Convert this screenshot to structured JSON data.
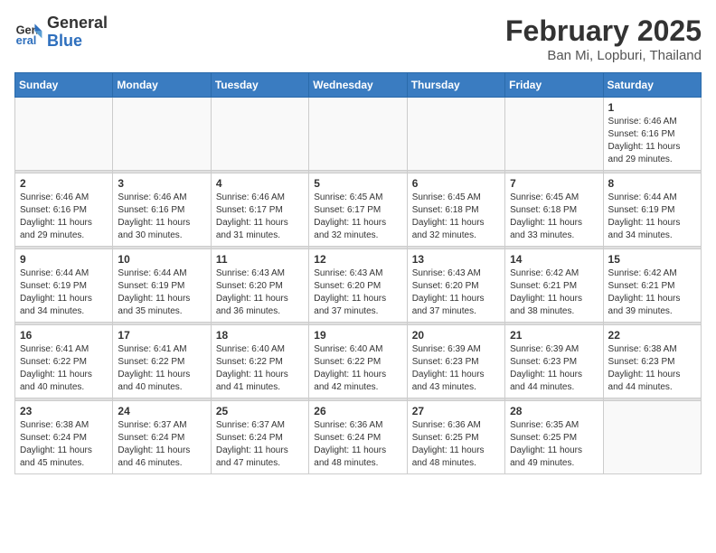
{
  "header": {
    "logo_general": "General",
    "logo_blue": "Blue",
    "month_title": "February 2025",
    "location": "Ban Mi, Lopburi, Thailand"
  },
  "calendar": {
    "days_of_week": [
      "Sunday",
      "Monday",
      "Tuesday",
      "Wednesday",
      "Thursday",
      "Friday",
      "Saturday"
    ],
    "weeks": [
      [
        {
          "day": "",
          "info": ""
        },
        {
          "day": "",
          "info": ""
        },
        {
          "day": "",
          "info": ""
        },
        {
          "day": "",
          "info": ""
        },
        {
          "day": "",
          "info": ""
        },
        {
          "day": "",
          "info": ""
        },
        {
          "day": "1",
          "info": "Sunrise: 6:46 AM\nSunset: 6:16 PM\nDaylight: 11 hours and 29 minutes."
        }
      ],
      [
        {
          "day": "2",
          "info": "Sunrise: 6:46 AM\nSunset: 6:16 PM\nDaylight: 11 hours and 29 minutes."
        },
        {
          "day": "3",
          "info": "Sunrise: 6:46 AM\nSunset: 6:16 PM\nDaylight: 11 hours and 30 minutes."
        },
        {
          "day": "4",
          "info": "Sunrise: 6:46 AM\nSunset: 6:17 PM\nDaylight: 11 hours and 31 minutes."
        },
        {
          "day": "5",
          "info": "Sunrise: 6:45 AM\nSunset: 6:17 PM\nDaylight: 11 hours and 32 minutes."
        },
        {
          "day": "6",
          "info": "Sunrise: 6:45 AM\nSunset: 6:18 PM\nDaylight: 11 hours and 32 minutes."
        },
        {
          "day": "7",
          "info": "Sunrise: 6:45 AM\nSunset: 6:18 PM\nDaylight: 11 hours and 33 minutes."
        },
        {
          "day": "8",
          "info": "Sunrise: 6:44 AM\nSunset: 6:19 PM\nDaylight: 11 hours and 34 minutes."
        }
      ],
      [
        {
          "day": "9",
          "info": "Sunrise: 6:44 AM\nSunset: 6:19 PM\nDaylight: 11 hours and 34 minutes."
        },
        {
          "day": "10",
          "info": "Sunrise: 6:44 AM\nSunset: 6:19 PM\nDaylight: 11 hours and 35 minutes."
        },
        {
          "day": "11",
          "info": "Sunrise: 6:43 AM\nSunset: 6:20 PM\nDaylight: 11 hours and 36 minutes."
        },
        {
          "day": "12",
          "info": "Sunrise: 6:43 AM\nSunset: 6:20 PM\nDaylight: 11 hours and 37 minutes."
        },
        {
          "day": "13",
          "info": "Sunrise: 6:43 AM\nSunset: 6:20 PM\nDaylight: 11 hours and 37 minutes."
        },
        {
          "day": "14",
          "info": "Sunrise: 6:42 AM\nSunset: 6:21 PM\nDaylight: 11 hours and 38 minutes."
        },
        {
          "day": "15",
          "info": "Sunrise: 6:42 AM\nSunset: 6:21 PM\nDaylight: 11 hours and 39 minutes."
        }
      ],
      [
        {
          "day": "16",
          "info": "Sunrise: 6:41 AM\nSunset: 6:22 PM\nDaylight: 11 hours and 40 minutes."
        },
        {
          "day": "17",
          "info": "Sunrise: 6:41 AM\nSunset: 6:22 PM\nDaylight: 11 hours and 40 minutes."
        },
        {
          "day": "18",
          "info": "Sunrise: 6:40 AM\nSunset: 6:22 PM\nDaylight: 11 hours and 41 minutes."
        },
        {
          "day": "19",
          "info": "Sunrise: 6:40 AM\nSunset: 6:22 PM\nDaylight: 11 hours and 42 minutes."
        },
        {
          "day": "20",
          "info": "Sunrise: 6:39 AM\nSunset: 6:23 PM\nDaylight: 11 hours and 43 minutes."
        },
        {
          "day": "21",
          "info": "Sunrise: 6:39 AM\nSunset: 6:23 PM\nDaylight: 11 hours and 44 minutes."
        },
        {
          "day": "22",
          "info": "Sunrise: 6:38 AM\nSunset: 6:23 PM\nDaylight: 11 hours and 44 minutes."
        }
      ],
      [
        {
          "day": "23",
          "info": "Sunrise: 6:38 AM\nSunset: 6:24 PM\nDaylight: 11 hours and 45 minutes."
        },
        {
          "day": "24",
          "info": "Sunrise: 6:37 AM\nSunset: 6:24 PM\nDaylight: 11 hours and 46 minutes."
        },
        {
          "day": "25",
          "info": "Sunrise: 6:37 AM\nSunset: 6:24 PM\nDaylight: 11 hours and 47 minutes."
        },
        {
          "day": "26",
          "info": "Sunrise: 6:36 AM\nSunset: 6:24 PM\nDaylight: 11 hours and 48 minutes."
        },
        {
          "day": "27",
          "info": "Sunrise: 6:36 AM\nSunset: 6:25 PM\nDaylight: 11 hours and 48 minutes."
        },
        {
          "day": "28",
          "info": "Sunrise: 6:35 AM\nSunset: 6:25 PM\nDaylight: 11 hours and 49 minutes."
        },
        {
          "day": "",
          "info": ""
        }
      ]
    ]
  }
}
